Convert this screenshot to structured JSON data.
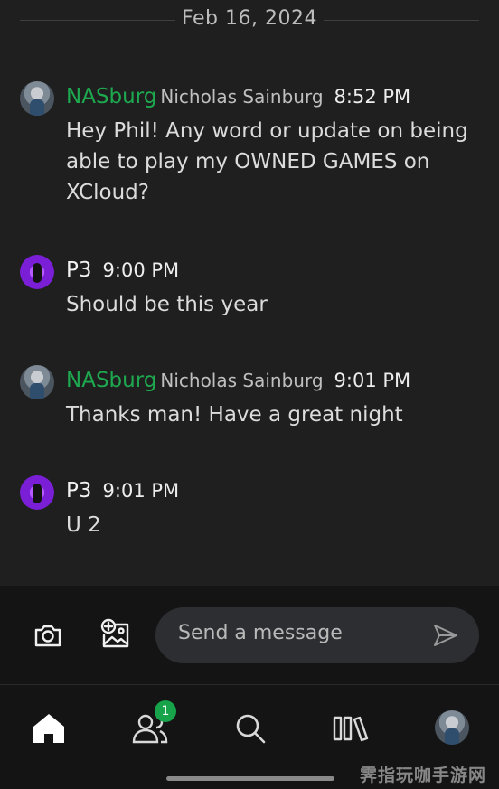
{
  "conversation": {
    "date": "Feb 16, 2024",
    "messages": [
      {
        "gamertag": "NASburg",
        "real_name": "Nicholas Sainburg",
        "time": "8:52 PM",
        "text": "Hey Phil! Any word or update on being able to play my OWNED GAMES on XCloud?"
      },
      {
        "gamertag": "P3",
        "real_name": "",
        "time": "9:00 PM",
        "text": "Should be this year"
      },
      {
        "gamertag": "NASburg",
        "real_name": "Nicholas Sainburg",
        "time": "9:01 PM",
        "text": "Thanks man! Have a great night"
      },
      {
        "gamertag": "P3",
        "real_name": "",
        "time": "9:01 PM",
        "text": "U 2"
      }
    ]
  },
  "composer": {
    "placeholder": "Send a message",
    "camera_icon": "camera-icon",
    "add_image_icon": "add-image-icon",
    "send_icon": "send-icon"
  },
  "nav": {
    "items": [
      {
        "name": "home",
        "icon": "home-icon",
        "active": true
      },
      {
        "name": "friends",
        "icon": "people-icon",
        "badge": "1"
      },
      {
        "name": "search",
        "icon": "search-icon"
      },
      {
        "name": "library",
        "icon": "library-icon"
      },
      {
        "name": "profile",
        "icon": "avatar"
      }
    ]
  },
  "watermark": "霁指玩咖手游网",
  "colors": {
    "gamertag_green": "#1ea84f",
    "background": "#1f1f1f",
    "composer_bg": "#141414",
    "badge_green": "#16a34a"
  }
}
